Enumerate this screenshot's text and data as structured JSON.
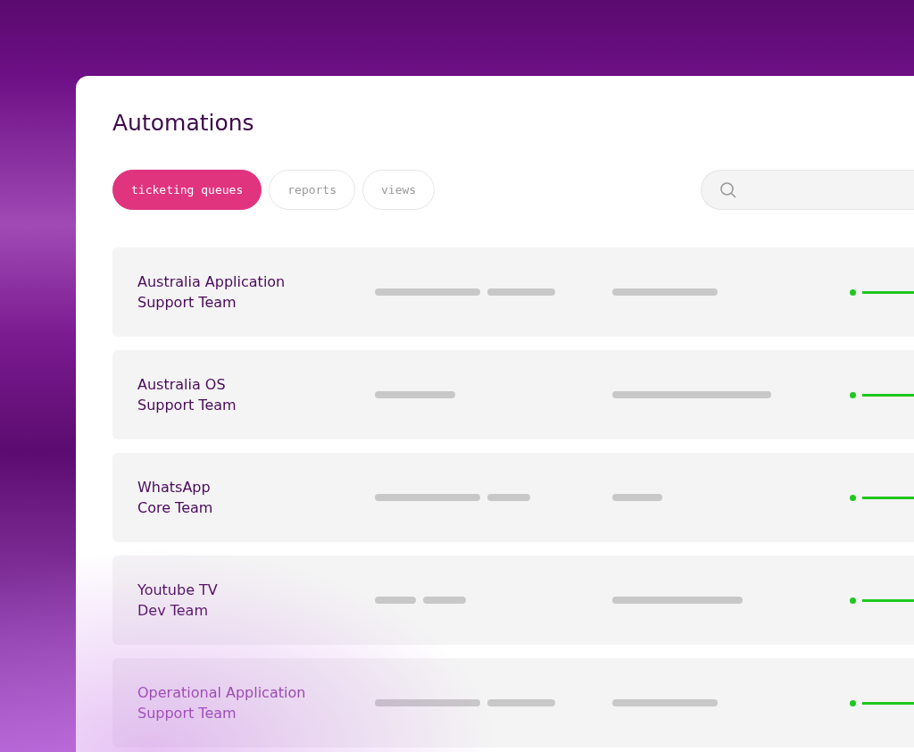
{
  "title": "Automations",
  "tabs": [
    {
      "label": "ticketing queues",
      "selected": true
    },
    {
      "label": "reports",
      "selected": false
    },
    {
      "label": "views",
      "selected": false
    }
  ],
  "rows": [
    {
      "name": "Australia Application\nSupport Team"
    },
    {
      "name": "Australia OS\nSupport Team"
    },
    {
      "name": "WhatsApp\nCore Team"
    },
    {
      "name": "Youtube TV\nDev Team"
    },
    {
      "name": "Operational Application\nSupport Team"
    }
  ]
}
